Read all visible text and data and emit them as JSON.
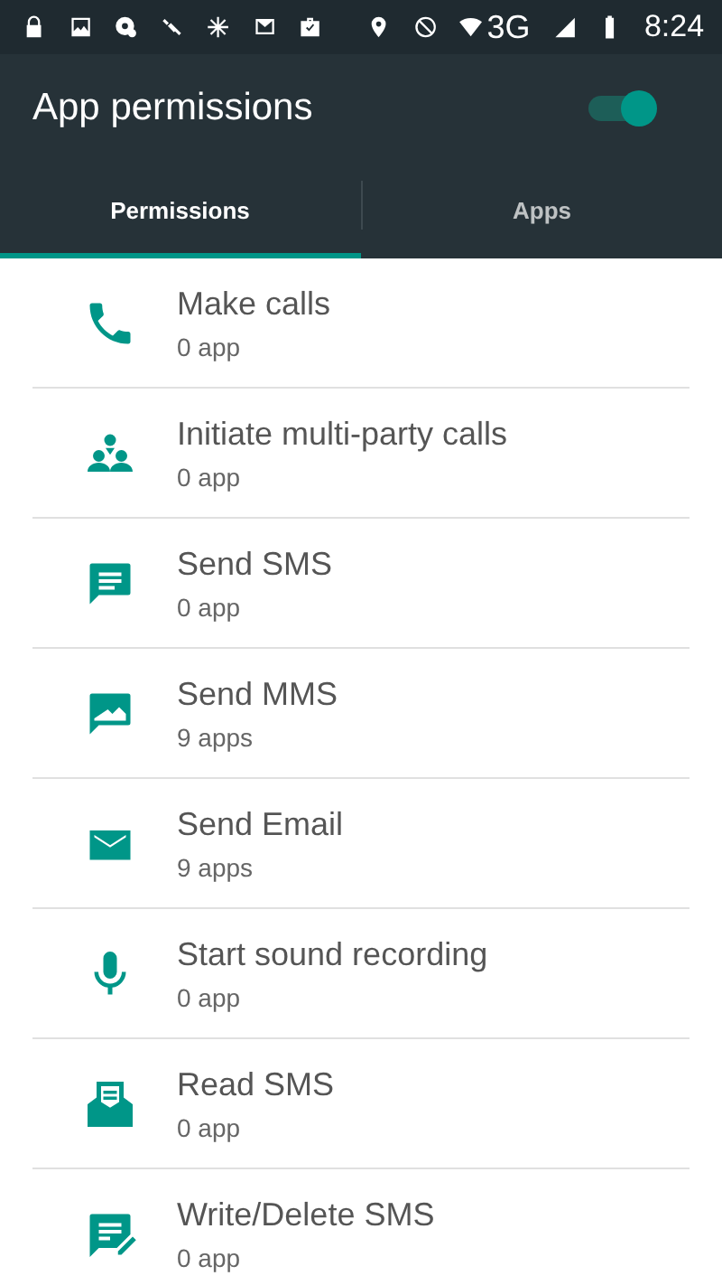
{
  "status_bar": {
    "network": "3G",
    "time": "8:24"
  },
  "app_bar": {
    "title": "App permissions",
    "toggle": {
      "on": true
    }
  },
  "tabs": [
    {
      "label": "Permissions",
      "selected": true
    },
    {
      "label": "Apps",
      "selected": false
    }
  ],
  "permissions": [
    {
      "kind": "phone",
      "name": "Make calls",
      "count": "0 app"
    },
    {
      "kind": "group",
      "name": "Initiate multi-party calls",
      "count": "0 app"
    },
    {
      "kind": "sms",
      "name": "Send SMS",
      "count": "0 app"
    },
    {
      "kind": "mms",
      "name": "Send MMS",
      "count": "9 apps"
    },
    {
      "kind": "email",
      "name": "Send Email",
      "count": "9 apps"
    },
    {
      "kind": "mic",
      "name": "Start sound recording",
      "count": "0 app"
    },
    {
      "kind": "read",
      "name": "Read SMS",
      "count": "0 app"
    },
    {
      "kind": "write",
      "name": "Write/Delete SMS",
      "count": "0 app"
    }
  ]
}
